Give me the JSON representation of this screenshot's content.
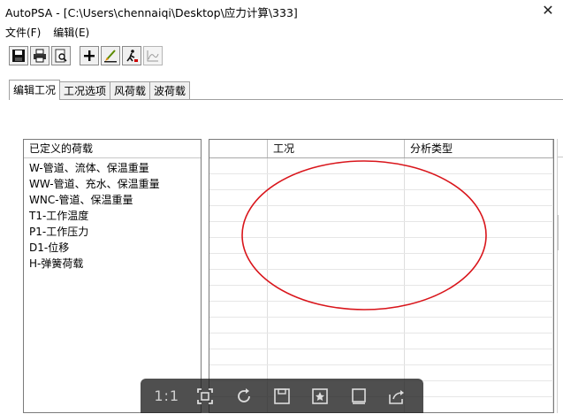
{
  "window": {
    "title": "AutoPSA - [C:\\Users\\chennaiqi\\Desktop\\应力计算\\333]",
    "close_glyph": "✕"
  },
  "menu": [
    "文件(F)",
    "编辑(E)"
  ],
  "toolbar": {
    "buttons": [
      {
        "icon": "save-icon"
      },
      {
        "icon": "print-icon"
      },
      {
        "icon": "print-preview-icon"
      },
      {
        "icon": "add-icon"
      },
      {
        "icon": "edit-load-icon"
      },
      {
        "icon": "run-analysis-icon"
      },
      {
        "icon": "chart-icon"
      }
    ]
  },
  "tabs": [
    {
      "label": "编辑工况",
      "active": true
    },
    {
      "label": "工况选项",
      "active": false
    },
    {
      "label": "风荷载",
      "active": false
    },
    {
      "label": "波荷载",
      "active": false
    }
  ],
  "defined_loads": {
    "header": "已定义的荷载",
    "items": [
      "W-管道、流体、保温重量",
      "WW-管道、充水、保温重量",
      "WNC-管道、保温重量",
      "T1-工作温度",
      "P1-工作压力",
      "D1-位移",
      "H-弹簧荷载"
    ]
  },
  "cases_grid": {
    "columns": [
      "",
      "工况",
      "分析类型"
    ],
    "row_count": 16
  },
  "viewer_bar": {
    "ratio_label": "1:1",
    "buttons": [
      "fit-screen-icon",
      "rotate-icon",
      "save-icon",
      "favorite-icon",
      "window-icon",
      "share-icon"
    ]
  },
  "colors": {
    "annotation": "#d9151b",
    "viewer_bg": "#1e1e1e"
  }
}
